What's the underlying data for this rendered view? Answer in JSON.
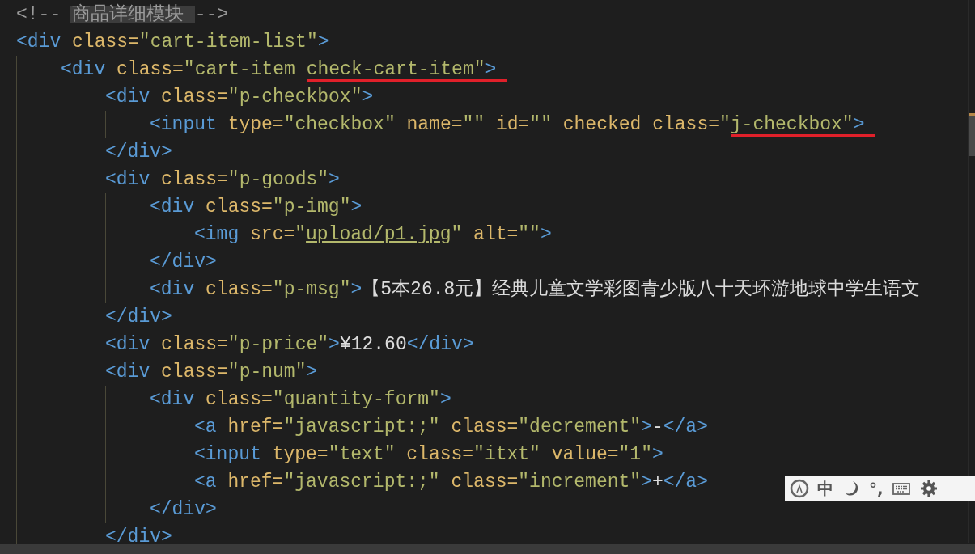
{
  "code_lines": [
    {
      "tokens": [
        {
          "kind": "comment",
          "text": "<!-- "
        },
        {
          "kind": "comment",
          "text": "商品详细模块 ",
          "highlighted": true
        },
        {
          "kind": "comment",
          "text": "-->"
        }
      ]
    },
    {
      "tokens": [
        {
          "kind": "tag",
          "text": "<div"
        },
        {
          "kind": "attr",
          "text": " class="
        },
        {
          "kind": "string",
          "text": "\"cart-item-list\""
        },
        {
          "kind": "tag",
          "text": ">"
        }
      ],
      "children": [
        {
          "tokens": [
            {
              "kind": "tag",
              "text": "<div"
            },
            {
              "kind": "attr",
              "text": " class="
            },
            {
              "kind": "string",
              "text": "\"cart-item "
            },
            {
              "kind": "string",
              "text": "check-cart-item",
              "underlined": true
            },
            {
              "kind": "string",
              "text": "\""
            },
            {
              "kind": "tag",
              "text": ">"
            }
          ],
          "children": [
            {
              "tokens": [
                {
                  "kind": "tag",
                  "text": "<div"
                },
                {
                  "kind": "attr",
                  "text": " class="
                },
                {
                  "kind": "string",
                  "text": "\"p-checkbox\""
                },
                {
                  "kind": "tag",
                  "text": ">"
                }
              ],
              "children": [
                {
                  "tokens": [
                    {
                      "kind": "tag",
                      "text": "<input"
                    },
                    {
                      "kind": "attr",
                      "text": " type="
                    },
                    {
                      "kind": "string",
                      "text": "\"checkbox\""
                    },
                    {
                      "kind": "attr",
                      "text": " name="
                    },
                    {
                      "kind": "string",
                      "text": "\"\""
                    },
                    {
                      "kind": "attr",
                      "text": " id="
                    },
                    {
                      "kind": "string",
                      "text": "\"\""
                    },
                    {
                      "kind": "attr",
                      "text": " checked class="
                    },
                    {
                      "kind": "string",
                      "text": "\""
                    },
                    {
                      "kind": "string",
                      "text": "j-checkbox",
                      "underlined": true
                    },
                    {
                      "kind": "string",
                      "text": "\""
                    },
                    {
                      "kind": "tag",
                      "text": ">"
                    }
                  ]
                }
              ]
            },
            {
              "tokens": [
                {
                  "kind": "tag",
                  "text": "</div>"
                }
              ]
            },
            {
              "tokens": [
                {
                  "kind": "tag",
                  "text": "<div"
                },
                {
                  "kind": "attr",
                  "text": " class="
                },
                {
                  "kind": "string",
                  "text": "\"p-goods\""
                },
                {
                  "kind": "tag",
                  "text": ">"
                }
              ],
              "children": [
                {
                  "tokens": [
                    {
                      "kind": "tag",
                      "text": "<div"
                    },
                    {
                      "kind": "attr",
                      "text": " class="
                    },
                    {
                      "kind": "string",
                      "text": "\"p-img\""
                    },
                    {
                      "kind": "tag",
                      "text": ">"
                    }
                  ],
                  "children": [
                    {
                      "tokens": [
                        {
                          "kind": "tag",
                          "text": "<img"
                        },
                        {
                          "kind": "attr",
                          "text": " src="
                        },
                        {
                          "kind": "string",
                          "text": "\""
                        },
                        {
                          "kind": "link",
                          "text": "upload/p1.jpg"
                        },
                        {
                          "kind": "string",
                          "text": "\""
                        },
                        {
                          "kind": "attr",
                          "text": " alt="
                        },
                        {
                          "kind": "string",
                          "text": "\"\""
                        },
                        {
                          "kind": "tag",
                          "text": ">"
                        }
                      ]
                    }
                  ]
                },
                {
                  "tokens": [
                    {
                      "kind": "tag",
                      "text": "</div>"
                    }
                  ]
                },
                {
                  "tokens": [
                    {
                      "kind": "tag",
                      "text": "<div"
                    },
                    {
                      "kind": "attr",
                      "text": " class="
                    },
                    {
                      "kind": "string",
                      "text": "\"p-msg\""
                    },
                    {
                      "kind": "tag",
                      "text": ">"
                    },
                    {
                      "kind": "text",
                      "text": "【5本26.8元】经典儿童文学彩图青少版八十天环游地球中学生语文"
                    }
                  ]
                }
              ]
            },
            {
              "tokens": [
                {
                  "kind": "tag",
                  "text": "</div>"
                }
              ]
            },
            {
              "tokens": [
                {
                  "kind": "tag",
                  "text": "<div"
                },
                {
                  "kind": "attr",
                  "text": " class="
                },
                {
                  "kind": "string",
                  "text": "\"p-price\""
                },
                {
                  "kind": "tag",
                  "text": ">"
                },
                {
                  "kind": "text",
                  "text": "¥12.60"
                },
                {
                  "kind": "tag",
                  "text": "</div>"
                }
              ]
            },
            {
              "tokens": [
                {
                  "kind": "tag",
                  "text": "<div"
                },
                {
                  "kind": "attr",
                  "text": " class="
                },
                {
                  "kind": "string",
                  "text": "\"p-num\""
                },
                {
                  "kind": "tag",
                  "text": ">"
                }
              ],
              "children": [
                {
                  "tokens": [
                    {
                      "kind": "tag",
                      "text": "<div"
                    },
                    {
                      "kind": "attr",
                      "text": " class="
                    },
                    {
                      "kind": "string",
                      "text": "\"quantity-form\""
                    },
                    {
                      "kind": "tag",
                      "text": ">"
                    }
                  ],
                  "children": [
                    {
                      "tokens": [
                        {
                          "kind": "tag",
                          "text": "<a"
                        },
                        {
                          "kind": "attr",
                          "text": " href="
                        },
                        {
                          "kind": "string",
                          "text": "\"javascript:;\""
                        },
                        {
                          "kind": "attr",
                          "text": " class="
                        },
                        {
                          "kind": "string",
                          "text": "\"decrement\""
                        },
                        {
                          "kind": "tag",
                          "text": ">"
                        },
                        {
                          "kind": "text",
                          "text": "-"
                        },
                        {
                          "kind": "tag",
                          "text": "</a>"
                        }
                      ]
                    },
                    {
                      "tokens": [
                        {
                          "kind": "tag",
                          "text": "<input"
                        },
                        {
                          "kind": "attr",
                          "text": " type="
                        },
                        {
                          "kind": "string",
                          "text": "\"text\""
                        },
                        {
                          "kind": "attr",
                          "text": " class="
                        },
                        {
                          "kind": "string",
                          "text": "\"itxt\""
                        },
                        {
                          "kind": "attr",
                          "text": " value="
                        },
                        {
                          "kind": "string",
                          "text": "\"1\""
                        },
                        {
                          "kind": "tag",
                          "text": ">"
                        }
                      ]
                    },
                    {
                      "tokens": [
                        {
                          "kind": "tag",
                          "text": "<a"
                        },
                        {
                          "kind": "attr",
                          "text": " href="
                        },
                        {
                          "kind": "string",
                          "text": "\"javascript:;\""
                        },
                        {
                          "kind": "attr",
                          "text": " class="
                        },
                        {
                          "kind": "string",
                          "text": "\"increment\""
                        },
                        {
                          "kind": "tag",
                          "text": ">"
                        },
                        {
                          "kind": "text",
                          "text": "+"
                        },
                        {
                          "kind": "tag",
                          "text": "</a>"
                        }
                      ]
                    }
                  ]
                },
                {
                  "tokens": [
                    {
                      "kind": "tag",
                      "text": "</div>"
                    }
                  ]
                }
              ]
            },
            {
              "tokens": [
                {
                  "kind": "tag",
                  "text": "</div>"
                }
              ]
            }
          ]
        }
      ]
    }
  ],
  "ime_toolbar": {
    "mode": "中",
    "punctuation": "°,"
  }
}
